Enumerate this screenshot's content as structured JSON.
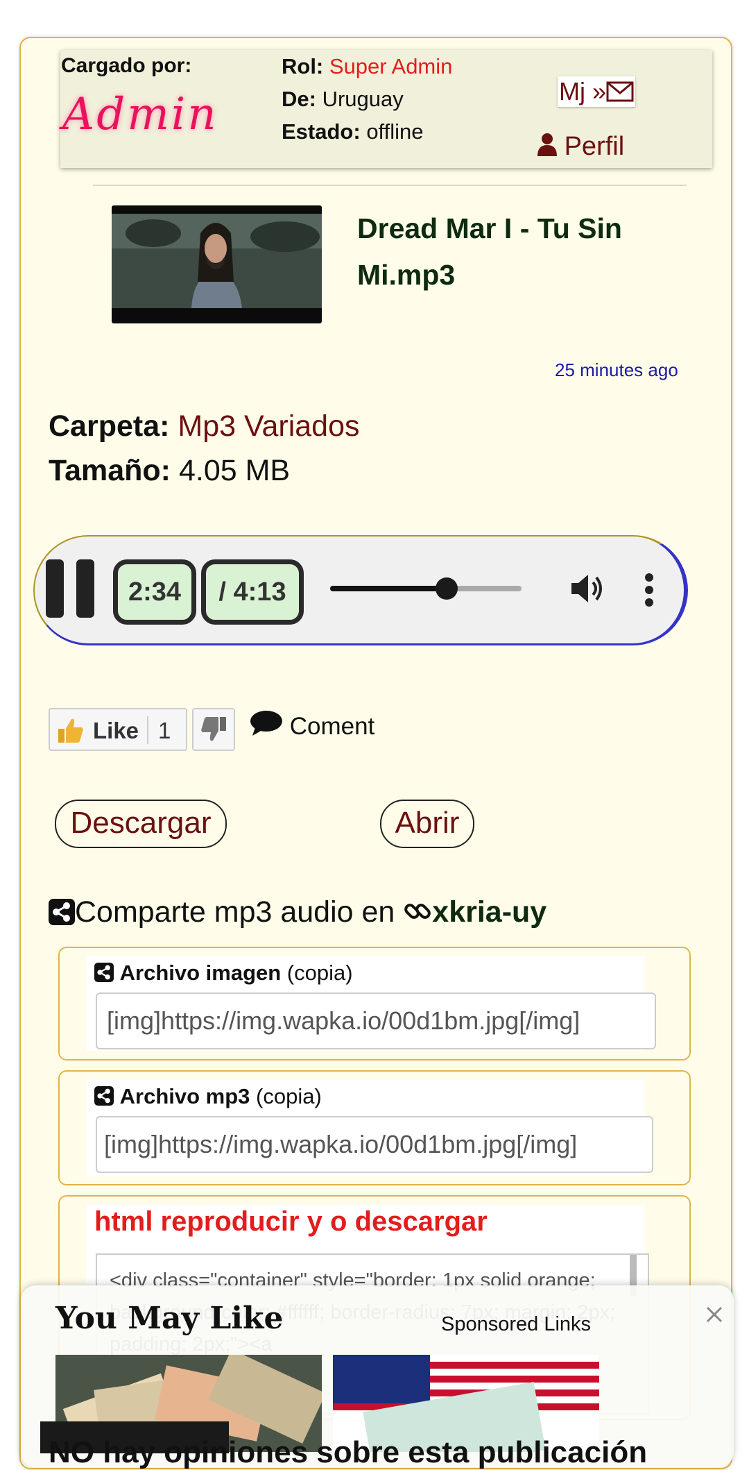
{
  "uploader": {
    "label": "Cargado por:",
    "name": "Admin",
    "role_label": "Rol:",
    "role_value": "Super Admin",
    "from_label": "De:",
    "from_value": "Uruguay",
    "status_label": "Estado:",
    "status_value": "offline",
    "message_button": "Mj »",
    "profile_button": "Perfil"
  },
  "file": {
    "title": "Dread Mar I - Tu Sin Mi.mp3",
    "time_ago": "25 minutes ago",
    "folder_label": "Carpeta:",
    "folder_value": "Mp3 Variados",
    "size_label": "Tamaño:",
    "size_value": "4.05 MB"
  },
  "player": {
    "current_time": "2:34",
    "duration": "/ 4:13",
    "progress": 0.61
  },
  "reactions": {
    "like_label": "Like",
    "like_count": "1",
    "comment_label": "Coment"
  },
  "actions": {
    "download_label": "Descargar",
    "open_label": "Abrir"
  },
  "share": {
    "heading_text": "Comparte mp3 audio en ",
    "site": "xkria-uy",
    "image_file": {
      "title": "Archivo imagen",
      "suffix": " (copia)",
      "value": "[img]https://img.wapka.io/00d1bm.jpg[/img]"
    },
    "mp3_file": {
      "title": "Archivo mp3",
      "suffix": " (copia)",
      "value": "[img]https://img.wapka.io/00d1bm.jpg[/img]"
    },
    "html_embed": {
      "title": "html reproducir y o descargar",
      "code": "<div class=\"container\" style=\"border: 1px solid orange; background-color: #ffffff; border-radius: 7px; margin: 2px; padding: 2px;\"><a"
    }
  },
  "ad": {
    "title": "You May Like",
    "sponsored": "Sponsored Links"
  },
  "footer_text": "NO hay opiniones sobre esta publicación"
}
